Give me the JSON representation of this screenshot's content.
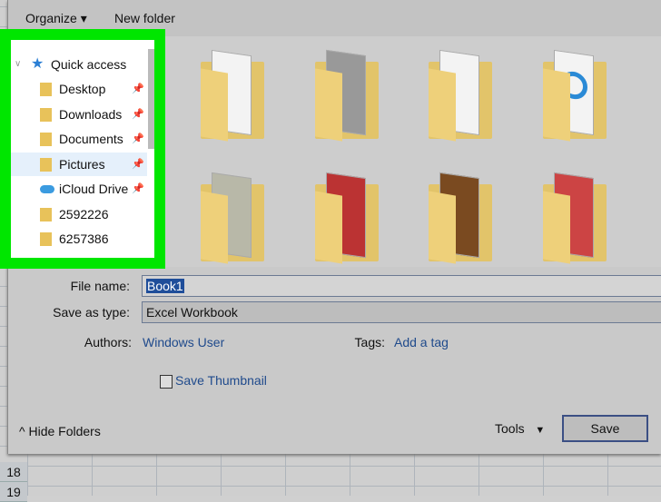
{
  "toolbar": {
    "organize": "Organize",
    "new_folder": "New folder"
  },
  "nav": {
    "header": "Quick access",
    "items": [
      {
        "label": "Desktop",
        "pinned": true,
        "icon": "desktop-folder-icon"
      },
      {
        "label": "Downloads",
        "pinned": true,
        "icon": "downloads-folder-icon"
      },
      {
        "label": "Documents",
        "pinned": true,
        "icon": "documents-folder-icon"
      },
      {
        "label": "Pictures",
        "pinned": true,
        "icon": "pictures-folder-icon",
        "selected": true
      },
      {
        "label": "iCloud Drive",
        "pinned": true,
        "icon": "cloud-icon"
      },
      {
        "label": "2592226",
        "pinned": false,
        "icon": "folder-icon"
      },
      {
        "label": "6257386",
        "pinned": false,
        "icon": "folder-icon"
      }
    ]
  },
  "form": {
    "file_name_label": "File name:",
    "file_name_value": "Book1",
    "type_label": "Save as type:",
    "type_value": "Excel Workbook",
    "authors_label": "Authors:",
    "authors_value": "Windows User",
    "tags_label": "Tags:",
    "tags_value": "Add a tag",
    "thumbnail_label": "Save Thumbnail"
  },
  "footer": {
    "hide_folders": "Hide Folders",
    "tools": "Tools",
    "save": "Save"
  },
  "sheet": {
    "rows": [
      "18",
      "19"
    ]
  },
  "colors": {
    "highlight": "#00e600",
    "accent": "#1f4e9a"
  }
}
